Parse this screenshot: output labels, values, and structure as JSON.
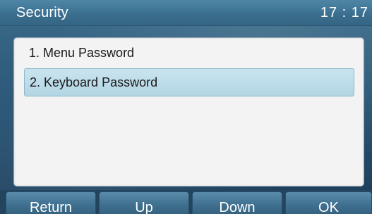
{
  "header": {
    "title": "Security",
    "time": "17 : 17"
  },
  "menu": {
    "items": [
      {
        "label": "1. Menu Password",
        "selected": false
      },
      {
        "label": "2. Keyboard Password",
        "selected": true
      }
    ]
  },
  "softkeys": {
    "return_label": "Return",
    "up_label": "Up",
    "down_label": "Down",
    "ok_label": "OK"
  },
  "colors": {
    "titlebar": "#3a6d8d",
    "selection": "#b3d5e4",
    "panel": "#f2f3f2"
  }
}
